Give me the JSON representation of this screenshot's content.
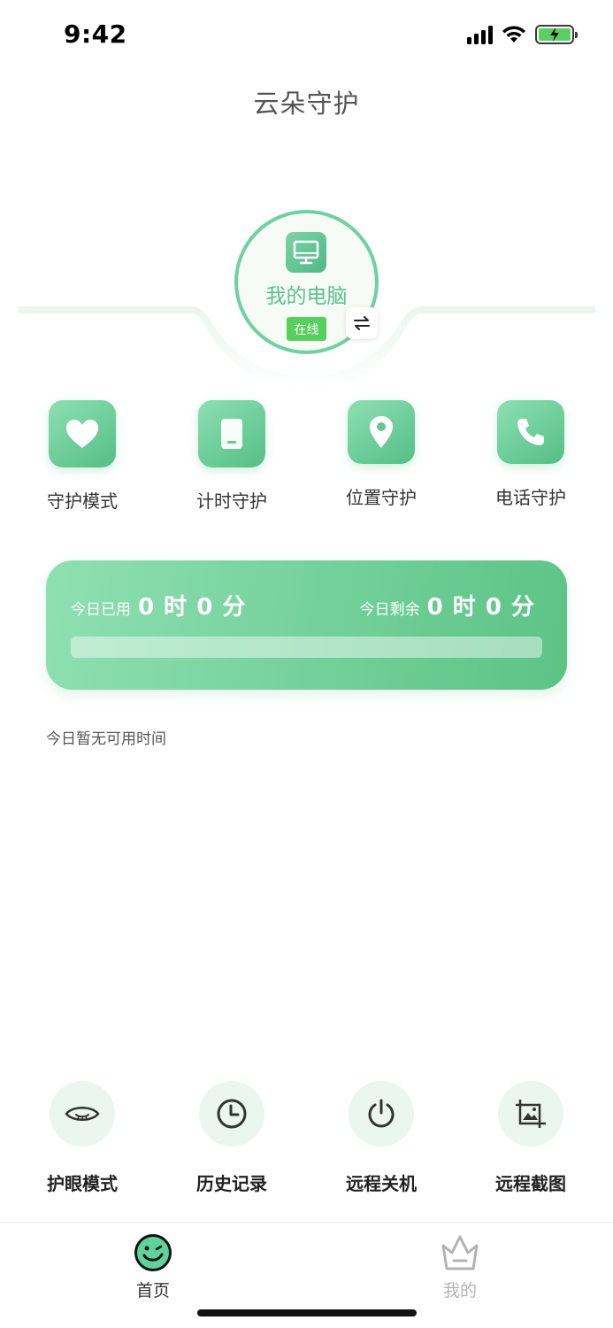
{
  "status": {
    "time": "9:42"
  },
  "header": {
    "title": "云朵守护"
  },
  "device": {
    "name": "我的电脑",
    "status": "在线",
    "icon": "monitor-icon",
    "switch_icon": "switch-device-icon"
  },
  "features": [
    {
      "label": "守护模式",
      "icon": "heart-icon"
    },
    {
      "label": "计时守护",
      "icon": "phone-timer-icon"
    },
    {
      "label": "位置守护",
      "icon": "location-pin-icon"
    },
    {
      "label": "电话守护",
      "icon": "phone-call-icon"
    }
  ],
  "usage": {
    "used_label": "今日已用",
    "used_value": "0 时 0 分",
    "remaining_label": "今日剩余",
    "remaining_value": "0 时 0 分",
    "progress": 0,
    "note": "今日暂无可用时间"
  },
  "tools": [
    {
      "label": "护眼模式",
      "icon": "eye-icon"
    },
    {
      "label": "历史记录",
      "icon": "clock-icon"
    },
    {
      "label": "远程关机",
      "icon": "power-icon"
    },
    {
      "label": "远程截图",
      "icon": "screenshot-icon"
    }
  ],
  "tabs": [
    {
      "label": "首页",
      "icon": "home-face-icon",
      "active": true
    },
    {
      "label": "我的",
      "icon": "crown-icon",
      "active": false
    }
  ],
  "colors": {
    "accent": "#5cc385",
    "accent_light": "#8fe0b2",
    "online": "#57cf5f",
    "tab_active": "#333333",
    "tab_inactive": "#b3b3b3"
  }
}
